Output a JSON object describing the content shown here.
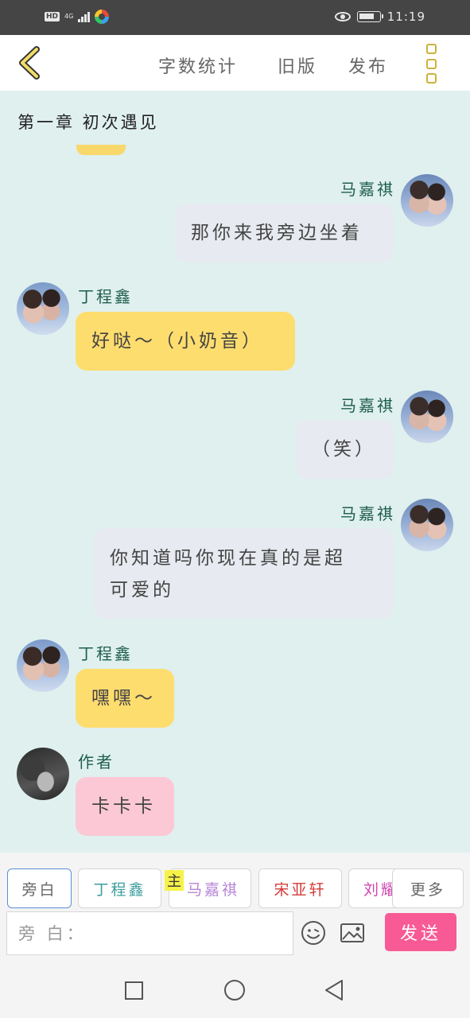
{
  "status_bar": {
    "hd": "HD",
    "network": "4G",
    "time": "11:19"
  },
  "topbar": {
    "back_icon": "chevron-left-icon",
    "word_count": "字数统计",
    "old_version": "旧版",
    "publish": "发布",
    "menu_icon": "vertical-menu-icon"
  },
  "chat": {
    "chapter_title": "第一章  初次遇见",
    "messages": [
      {
        "sender": "马嘉祺",
        "text": "那你来我旁边坐着",
        "side": "right"
      },
      {
        "sender": "丁程鑫",
        "text": "好哒～（小奶音）",
        "side": "left"
      },
      {
        "sender": "马嘉祺",
        "text": "（笑）",
        "side": "right"
      },
      {
        "sender": "马嘉祺",
        "text_line1": "你知道吗你现在真的是超",
        "text_line2": "可爱的",
        "side": "right"
      },
      {
        "sender": "丁程鑫",
        "text": "嘿嘿～",
        "side": "left"
      },
      {
        "sender": "作者",
        "text": "卡卡卡",
        "side": "left"
      }
    ]
  },
  "roles": {
    "items": [
      "旁白",
      "丁程鑫",
      "马嘉祺",
      "宋亚轩",
      "刘耀"
    ],
    "main_tag": "主",
    "more": "更多"
  },
  "composer": {
    "placeholder": "旁 白：",
    "send_label": "发送"
  },
  "colors": {
    "bg": "#dff0ef",
    "yellow_bubble": "#fedd6f",
    "gray_bubble": "#e7eaf0",
    "pink_bubble": "#fcc8d5",
    "send_button": "#f75a94",
    "name_green": "#1f5e4a"
  }
}
